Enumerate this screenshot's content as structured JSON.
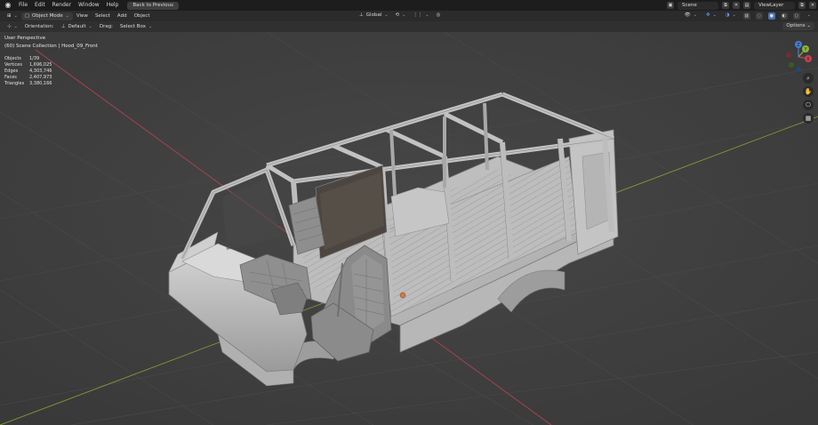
{
  "topbar": {
    "menus": [
      "File",
      "Edit",
      "Render",
      "Window",
      "Help"
    ],
    "back_button": "Back to Previous",
    "scene": "Scene",
    "view_layer": "ViewLayer"
  },
  "header": {
    "mode": "Object Mode",
    "menus": [
      "View",
      "Select",
      "Add",
      "Object"
    ],
    "transform": "Global"
  },
  "tool_header": {
    "orientation_label": "Orientation:",
    "orientation_value": "Default",
    "drag_label": "Drag:",
    "drag_value": "Select Box",
    "options": "Options"
  },
  "viewport": {
    "perspective": "User Perspective",
    "collection": "(60) Scene Collection | Hood_09_Front",
    "stats": [
      {
        "label": "Objects",
        "value": "1/39"
      },
      {
        "label": "Vertices",
        "value": "1,696,025"
      },
      {
        "label": "Edges",
        "value": "4,303,746"
      },
      {
        "label": "Faces",
        "value": "2,407,973"
      },
      {
        "label": "Triangles",
        "value": "3,380,166"
      }
    ]
  },
  "gizmo": {
    "x": "X",
    "y": "Y",
    "z": "Z"
  }
}
